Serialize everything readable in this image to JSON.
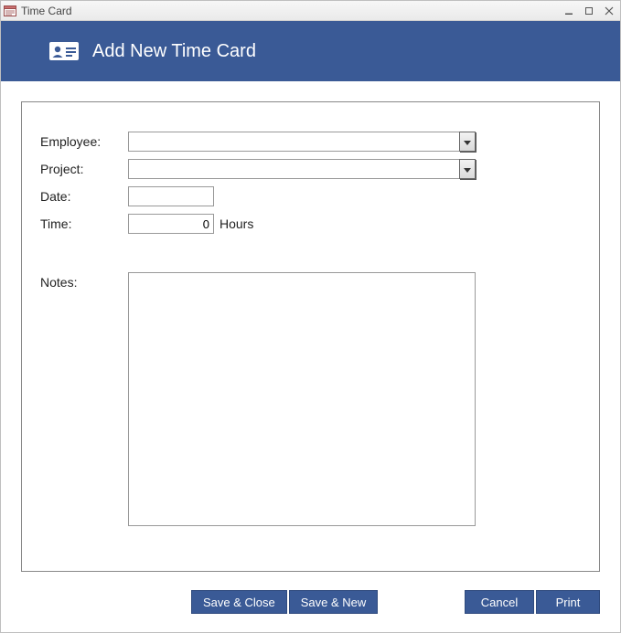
{
  "window": {
    "title": "Time Card"
  },
  "header": {
    "title": "Add New Time Card"
  },
  "form": {
    "employee_label": "Employee:",
    "employee_value": "",
    "project_label": "Project:",
    "project_value": "",
    "date_label": "Date:",
    "date_value": "",
    "time_label": "Time:",
    "time_value": "0",
    "time_unit": "Hours",
    "notes_label": "Notes:",
    "notes_value": ""
  },
  "buttons": {
    "save_close": "Save & Close",
    "save_new": "Save & New",
    "cancel": "Cancel",
    "print": "Print"
  }
}
